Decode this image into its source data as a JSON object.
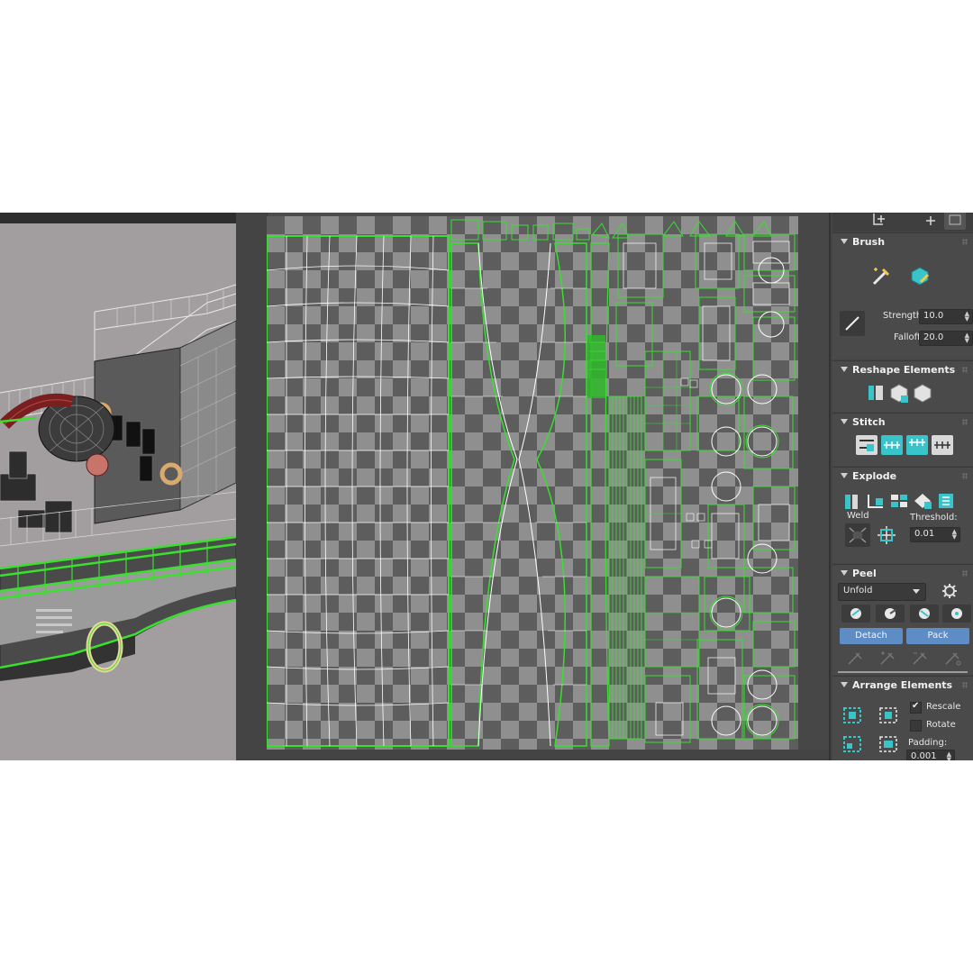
{
  "viewport": {
    "name": "3D viewport"
  },
  "uv_editor": {
    "name": "UV editor"
  },
  "panel": {
    "brush": {
      "title": "Brush",
      "strength_label": "Strength:",
      "strength_value": "10.0",
      "falloff_label": "Falloff:",
      "falloff_value": "20.0"
    },
    "reshape": {
      "title": "Reshape Elements"
    },
    "stitch": {
      "title": "Stitch"
    },
    "explode": {
      "title": "Explode",
      "weld_label": "Weld",
      "threshold_label": "Threshold:",
      "threshold_value": "0.01"
    },
    "peel": {
      "title": "Peel",
      "mode_value": "Unfold",
      "detach_label": "Detach",
      "pack_label": "Pack"
    },
    "arrange": {
      "title": "Arrange Elements",
      "rescale_label": "Rescale",
      "rescale_checked": true,
      "rotate_label": "Rotate",
      "rotate_checked": false,
      "padding_label": "Padding:",
      "padding_value": "0.001"
    }
  },
  "colors": {
    "uv_edge": "#37e02f",
    "uv_inner": "#ffffff",
    "panel_bg": "#444444",
    "accent_teal": "#38c4c8",
    "button_blue": "#5e8cc4"
  }
}
